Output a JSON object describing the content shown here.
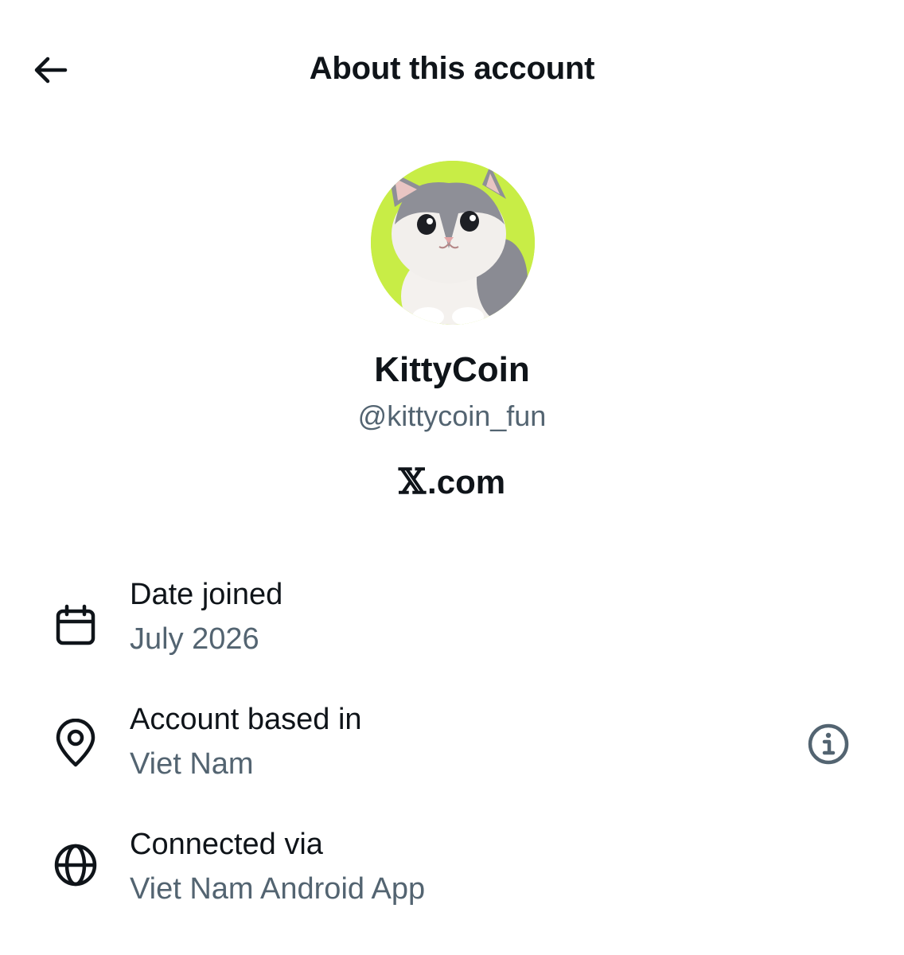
{
  "header": {
    "title": "About this account",
    "back_icon": "arrow-left-icon"
  },
  "profile": {
    "avatar_description_icon": "kitten-avatar",
    "avatar_bg_color": "#c8ed46",
    "display_name": "KittyCoin",
    "handle": "@kittycoin_fun",
    "site_mark": "𝕏",
    "site_suffix": ".com"
  },
  "details": [
    {
      "icon": "calendar-icon",
      "label": "Date joined",
      "value": "July 2026"
    },
    {
      "icon": "location-pin-icon",
      "label": "Account based in",
      "value": "Viet Nam",
      "action_icon": "info-icon"
    },
    {
      "icon": "globe-icon",
      "label": "Connected via",
      "value": "Viet Nam Android App"
    }
  ],
  "colors": {
    "primary_text": "#0f1419",
    "secondary_text": "#536471"
  }
}
